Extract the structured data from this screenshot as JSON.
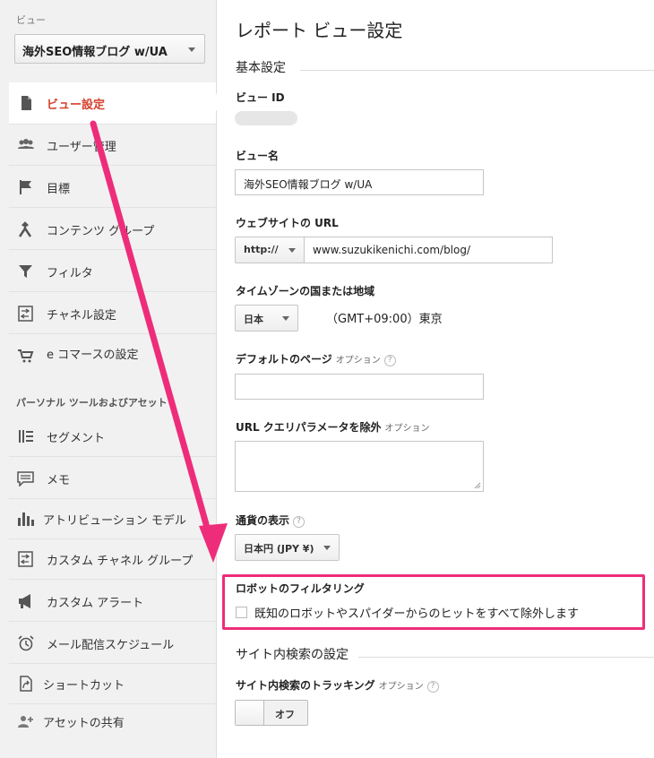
{
  "sidebar": {
    "view_label": "ビュー",
    "view_selector": "海外SEO情報ブログ w/UA",
    "items": [
      {
        "label": "ビュー設定",
        "icon": "document-icon"
      },
      {
        "label": "ユーザー管理",
        "icon": "users-icon"
      },
      {
        "label": "目標",
        "icon": "flag-icon"
      },
      {
        "label": "コンテンツ グループ",
        "icon": "content-group-icon"
      },
      {
        "label": "フィルタ",
        "icon": "filter-icon"
      },
      {
        "label": "チャネル設定",
        "icon": "channel-icon"
      },
      {
        "label": "e コマースの設定",
        "icon": "cart-icon"
      }
    ],
    "section_heading": "パーソナル ツールおよびアセット",
    "tools": [
      {
        "label": "セグメント",
        "icon": "segment-icon"
      },
      {
        "label": "メモ",
        "icon": "memo-icon"
      },
      {
        "label": "アトリビューション モデル",
        "icon": "bar-chart-icon"
      },
      {
        "label": "カスタム チャネル グループ",
        "icon": "custom-channel-icon"
      },
      {
        "label": "カスタム アラート",
        "icon": "megaphone-icon"
      },
      {
        "label": "メール配信スケジュール",
        "icon": "alarm-clock-icon"
      },
      {
        "label": "ショートカット",
        "icon": "shortcut-icon"
      },
      {
        "label": "アセットの共有",
        "icon": "add-user-icon"
      }
    ]
  },
  "main": {
    "title": "レポート ビュー設定",
    "basic_section": "基本設定",
    "view_id_label": "ビュー ID",
    "view_name_label": "ビュー名",
    "view_name_value": "海外SEO情報ブログ w/UA",
    "website_url_label": "ウェブサイトの URL",
    "protocol": "http://",
    "website_url_value": "www.suzukikenichi.com/blog/",
    "timezone_label": "タイムゾーンの国または地域",
    "country": "日本",
    "timezone": "（GMT+09:00）東京",
    "default_page_label": "デフォルトのページ",
    "optional": "オプション",
    "exclude_params_label": "URL クエリパラメータを除外",
    "currency_label": "通貨の表示",
    "currency_value": "日本円 (JPY ¥)",
    "bot_filter_label": "ロボットのフィルタリング",
    "bot_filter_checkbox": "既知のロボットやスパイダーからのヒットをすべて除外します",
    "site_search_section": "サイト内検索の設定",
    "site_search_tracking_label": "サイト内検索のトラッキング",
    "toggle_label": "オフ",
    "help_glyph": "?"
  },
  "colors": {
    "active_nav": "#d6402c",
    "highlight": "#ee2d7a",
    "arrow": "#ee2d7a"
  }
}
